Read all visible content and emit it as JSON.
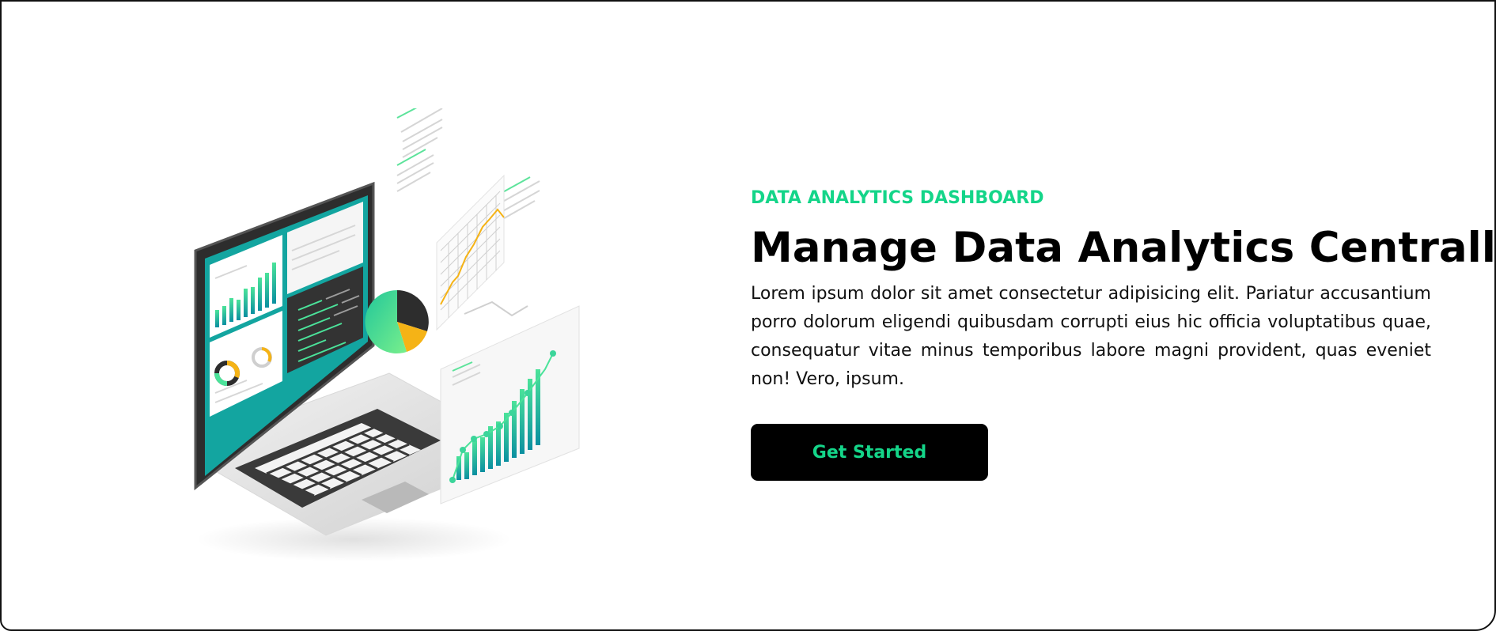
{
  "hero": {
    "eyebrow": "DATA ANALYTICS DASHBOARD",
    "headline": "Manage Data Analytics Centrally",
    "body": "Lorem ipsum dolor sit amet consectetur adipisicing elit. Pariatur accusantium porro dolorum eligendi quibusdam corrupti eius hic officia voluptatibus quae, consequatur vitae minus temporibus labore magni provident, quas eveniet non! Vero, ipsum.",
    "cta_label": "Get Started"
  },
  "colors": {
    "accent": "#14d589",
    "button_bg": "#000000",
    "headline": "#000000",
    "chart_orange": "#f5b316"
  },
  "illustration": {
    "icon": "laptop-analytics-illustration-icon"
  }
}
